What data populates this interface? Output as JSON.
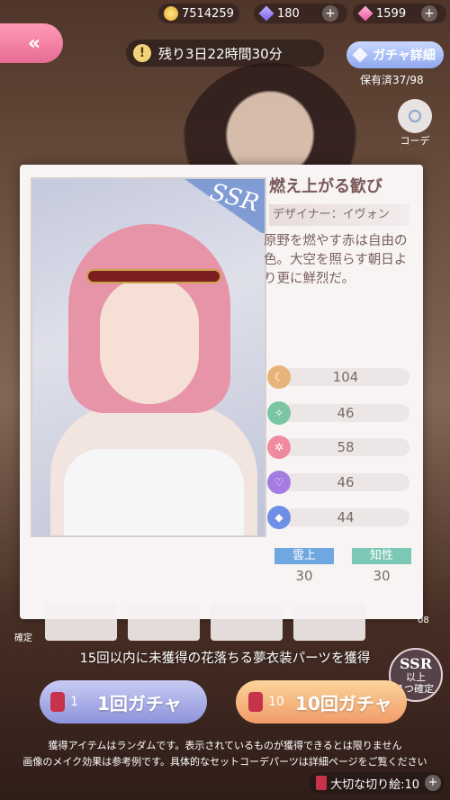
{
  "resources": {
    "coins": "7514259",
    "diamonds": "180",
    "pink_diamonds": "1599"
  },
  "timer": {
    "text": "残り3日22時間30分"
  },
  "gacha_detail": {
    "label": "ガチャ詳細"
  },
  "owned": {
    "text": "保有済37/98"
  },
  "coordinate": {
    "label": "コーデ"
  },
  "card": {
    "rarity": "SSR",
    "name": "燃え上がる歓び",
    "designer": "デザイナー：イヴォン",
    "description": "原野を燃やす赤は自由の色。大空を照らす朝日より更に鮮烈だ。",
    "stats": [
      {
        "value": "104",
        "color": "#e8b37a"
      },
      {
        "value": "46",
        "color": "#7bc6a2"
      },
      {
        "value": "58",
        "color": "#f08aa0"
      },
      {
        "value": "46",
        "color": "#a47be0"
      },
      {
        "value": "44",
        "color": "#6f8fe6"
      }
    ],
    "tags": [
      {
        "label": "雲上",
        "value": "30",
        "color": "#6fa7e0"
      },
      {
        "label": "知性",
        "value": "30",
        "color": "#7cc8b6"
      }
    ]
  },
  "misc": {
    "confirm": "確定",
    "side_number": "08"
  },
  "banner": {
    "text": "15回以内に未獲得の花落ちる夢衣装パーツを獲得"
  },
  "ssr_badge": {
    "line1": "SSR",
    "line2": "以上",
    "line3": "1つ確定"
  },
  "pull_one": {
    "count": "1",
    "label": "1回ガチャ"
  },
  "pull_ten": {
    "count": "10",
    "label": "10回ガチャ"
  },
  "notes": {
    "line1": "獲得アイテムはランダムです。表示されているものが獲得できるとは限りません",
    "line2": "画像のメイク効果は参考例です。具体的なセットコーデパーツは詳細ページをご覧ください"
  },
  "tickets": {
    "text": "大切な切り絵:10"
  }
}
